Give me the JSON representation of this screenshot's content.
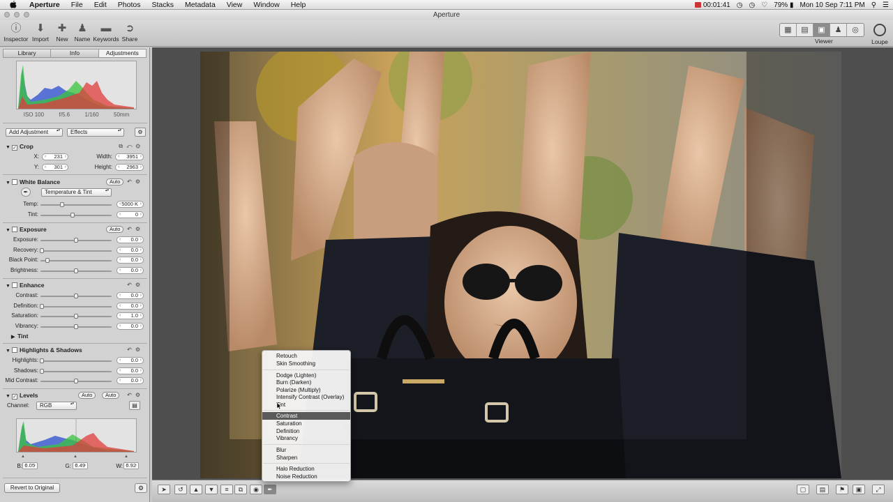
{
  "menubar": {
    "app": "Aperture",
    "items": [
      "File",
      "Edit",
      "Photos",
      "Stacks",
      "Metadata",
      "View",
      "Window",
      "Help"
    ],
    "recording": "00:01:41",
    "battery": "79%",
    "clock": "Mon 10 Sep  7:11 PM"
  },
  "window": {
    "title": "Aperture"
  },
  "toolbar": {
    "buttons": [
      "Inspector",
      "Import",
      "New",
      "Name",
      "Keywords",
      "Share"
    ],
    "viewer_label": "Viewer",
    "loupe_label": "Loupe"
  },
  "inspector": {
    "tabs": [
      "Library",
      "Info",
      "Adjustments"
    ],
    "exif": {
      "iso": "ISO 100",
      "aperture": "f/5.6",
      "shutter": "1/160",
      "focal": "50mm"
    },
    "add_adjustment": "Add Adjustment",
    "effects": "Effects",
    "crop": {
      "title": "Crop",
      "x_label": "X:",
      "x": "231",
      "y_label": "Y:",
      "y": "301",
      "width_label": "Width:",
      "width": "3951",
      "height_label": "Height:",
      "height": "2963"
    },
    "white_balance": {
      "title": "White Balance",
      "auto": "Auto",
      "mode": "Temperature & Tint",
      "temp_label": "Temp:",
      "temp": "5000 K",
      "temp_pos": 0.3,
      "tint_label": "Tint:",
      "tint": "0",
      "tint_pos": 0.45
    },
    "exposure": {
      "title": "Exposure",
      "auto": "Auto",
      "rows": [
        {
          "label": "Exposure:",
          "value": "0.0",
          "pos": 0.5
        },
        {
          "label": "Recovery:",
          "value": "0.0",
          "pos": 0.02
        },
        {
          "label": "Black Point:",
          "value": "0.0",
          "pos": 0.1
        },
        {
          "label": "Brightness:",
          "value": "0.0",
          "pos": 0.5
        }
      ]
    },
    "enhance": {
      "title": "Enhance",
      "rows": [
        {
          "label": "Contrast:",
          "value": "0.0",
          "pos": 0.5
        },
        {
          "label": "Definition:",
          "value": "0.0",
          "pos": 0.02
        },
        {
          "label": "Saturation:",
          "value": "1.0",
          "pos": 0.5
        },
        {
          "label": "Vibrancy:",
          "value": "0.0",
          "pos": 0.5
        }
      ],
      "tint": "Tint"
    },
    "highlights_shadows": {
      "title": "Highlights & Shadows",
      "rows": [
        {
          "label": "Highlights:",
          "value": "0.0",
          "pos": 0.02
        },
        {
          "label": "Shadows:",
          "value": "0.0",
          "pos": 0.02
        },
        {
          "label": "Mid Contrast:",
          "value": "0.0",
          "pos": 0.5
        }
      ]
    },
    "levels": {
      "title": "Levels",
      "auto1": "Auto",
      "auto2": "Auto",
      "channel_label": "Channel:",
      "channel": "RGB",
      "b_label": "B:",
      "b": "0.05",
      "g_label": "G:",
      "g": "0.49",
      "w_label": "W:",
      "w": "0.92"
    },
    "revert": "Revert to Original"
  },
  "brush_menu": {
    "items": [
      "Retouch",
      "Skin Smoothing",
      "Dodge (Lighten)",
      "Burn (Darken)",
      "Polarize (Multiply)",
      "Intensify Contrast (Overlay)",
      "Tint",
      "Contrast",
      "Saturation",
      "Definition",
      "Vibrancy",
      "Blur",
      "Sharpen",
      "Halo Reduction",
      "Noise Reduction"
    ],
    "highlighted": "Contrast"
  }
}
